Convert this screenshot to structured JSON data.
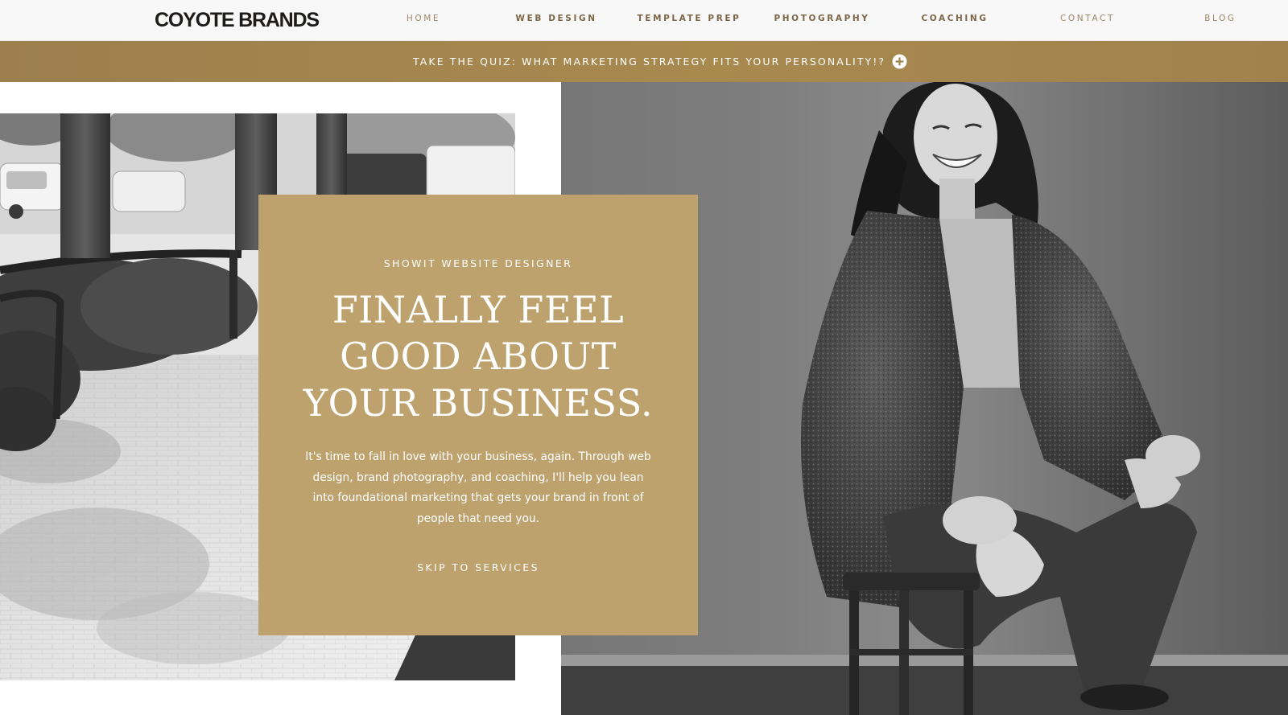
{
  "header": {
    "logo": "COYOTE BRANDS",
    "nav": [
      {
        "label": "HOME"
      },
      {
        "label": "WEB DESIGN"
      },
      {
        "label": "TEMPLATE PREP"
      },
      {
        "label": "PHOTOGRAPHY"
      },
      {
        "label": "COACHING"
      },
      {
        "label": "CONTACT"
      },
      {
        "label": "BLOG"
      }
    ]
  },
  "announcement": {
    "text": "TAKE THE QUIZ: WHAT MARKETING STRATEGY FITS YOUR PERSONALITY!?",
    "icon": "plus-circle-icon"
  },
  "hero": {
    "eyebrow": "SHOWIT WEBSITE DESIGNER",
    "headline": [
      "FINALLY FEEL",
      "GOOD ABOUT",
      "YOUR BUSINESS."
    ],
    "body": "It's time to fall in love with your business, again. Through web design, brand photography, and coaching, I'll help you lean into foundational marketing that gets your brand in front of people that need you.",
    "cta": "SKIP TO SERVICES"
  },
  "colors": {
    "gold_card": "#bea26d",
    "gold_bar": "#a1824d",
    "nav_text": "#9c876a",
    "nav_text_bold": "#7c6648",
    "logo": "#1e1c1a"
  }
}
